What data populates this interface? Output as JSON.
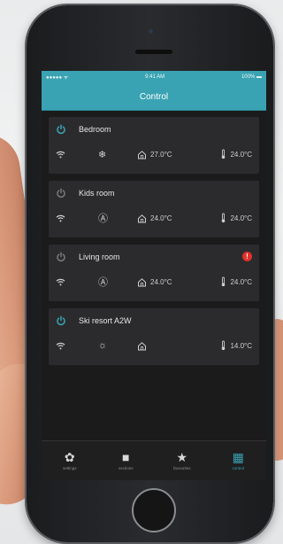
{
  "status": {
    "carrier": "●●●●● ᯤ",
    "time": "9:41 AM",
    "battery": "100% ▬"
  },
  "nav": {
    "title": "Control"
  },
  "devices": [
    {
      "name": "Bedroom",
      "power_on": true,
      "mode": "snowflake-icon",
      "mode_glyph": "❄",
      "indoor": "27.0°C",
      "target": "24.0°C",
      "alert": false
    },
    {
      "name": "Kids room",
      "power_on": false,
      "mode": "auto-icon",
      "mode_glyph": "Ⓐ",
      "indoor": "24.0°C",
      "target": "24.0°C",
      "alert": false
    },
    {
      "name": "Living room",
      "power_on": false,
      "mode": "auto-icon",
      "mode_glyph": "Ⓐ",
      "indoor": "24.0°C",
      "target": "24.0°C",
      "alert": true,
      "alert_text": "!"
    },
    {
      "name": "Ski resort A2W",
      "power_on": true,
      "mode": "sun-icon",
      "mode_glyph": "☼",
      "indoor": "",
      "target": "14.0°C",
      "alert": false
    }
  ],
  "tabs": [
    {
      "label": "settings",
      "icon": "gear-icon",
      "glyph": "✿",
      "active": false
    },
    {
      "label": "sections",
      "icon": "square-icon",
      "glyph": "■",
      "active": false
    },
    {
      "label": "favourites",
      "icon": "star-icon",
      "glyph": "★",
      "active": false
    },
    {
      "label": "control",
      "icon": "grid-icon",
      "glyph": "▦",
      "active": true
    }
  ],
  "colors": {
    "accent": "#3aa3b3",
    "power_on": "#3aa3b3",
    "power_off": "#7a7a7a",
    "alert": "#e2312b"
  }
}
